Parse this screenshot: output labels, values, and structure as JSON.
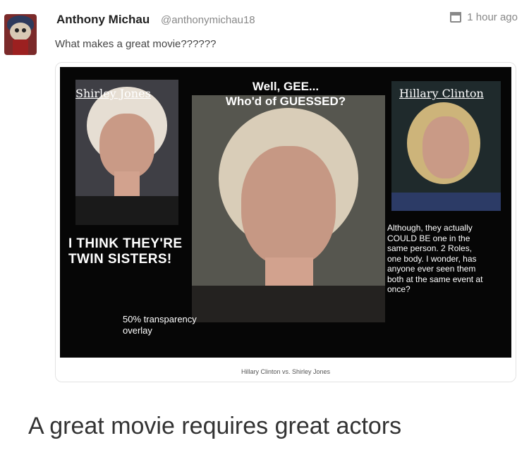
{
  "post": {
    "author": "Anthony Michau",
    "handle": "@anthonymichau18",
    "time": "1 hour ago",
    "text": "What makes a great movie??????",
    "time_icon": "calendar-icon"
  },
  "meme": {
    "title_line1": "Well, GEE...",
    "title_line2": "Who'd of GUESSED?",
    "caption_left": "Shirley Jones",
    "caption_right": "Hillary Clinton",
    "left_text_line1": "I THINK THEY'RE",
    "left_text_line2": "TWIN SISTERS!",
    "right_text_lines": [
      "Although, they actually",
      "COULD BE one in the",
      "same person. 2 Roles,",
      "one body. I wonder, has",
      "anyone ever seen them",
      "both at the same event at",
      "once?"
    ],
    "overlay_line1": "50% transparency",
    "overlay_line2": "overlay"
  },
  "card": {
    "caption": "Hillary Clinton vs. Shirley Jones"
  },
  "footer_text": "A great movie requires great actors"
}
